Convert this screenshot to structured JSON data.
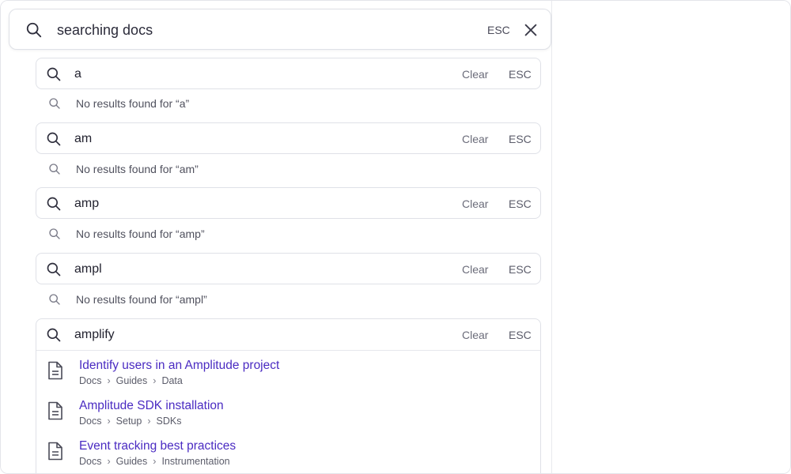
{
  "search": {
    "query": "searching docs",
    "esc_label": "ESC"
  },
  "queries": [
    {
      "text": "a",
      "clear_label": "Clear",
      "esc_label": "ESC",
      "no_results": "No results found for “a”"
    },
    {
      "text": "am",
      "clear_label": "Clear",
      "esc_label": "ESC",
      "no_results": "No results found for “am”"
    },
    {
      "text": "amp",
      "clear_label": "Clear",
      "esc_label": "ESC",
      "no_results": "No results found for “amp”"
    },
    {
      "text": "ampl",
      "clear_label": "Clear",
      "esc_label": "ESC",
      "no_results": "No results found for “ampl”"
    },
    {
      "text": "amplify",
      "clear_label": "Clear",
      "esc_label": "ESC"
    }
  ],
  "results": [
    {
      "title": "Identify users in an Amplitude project",
      "crumbs": [
        "Docs",
        "Guides",
        "Data"
      ]
    },
    {
      "title": "Amplitude SDK installation",
      "crumbs": [
        "Docs",
        "Setup",
        "SDKs"
      ]
    },
    {
      "title": "Event tracking best practices",
      "crumbs": [
        "Docs",
        "Guides",
        "Instrumentation"
      ]
    }
  ],
  "icons": {
    "search": "search-icon",
    "close": "close-icon",
    "document": "document-icon",
    "crumb_separator": "chevron-right-icon"
  },
  "colors": {
    "result_title": "#4a2bc2",
    "muted_text": "#6b6c7a",
    "border": "#dfe1e7"
  }
}
